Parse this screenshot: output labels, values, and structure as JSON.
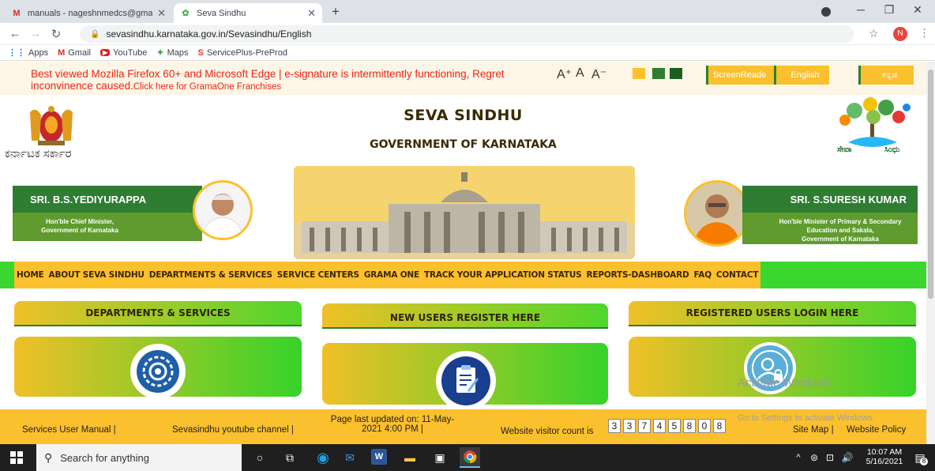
{
  "browser": {
    "tabs": [
      {
        "title": "manuals - nageshnmedcs@gmai",
        "icon": "gmail-icon",
        "active": false
      },
      {
        "title": "Seva Sindhu",
        "icon": "seva-sindhu-favicon",
        "active": true
      }
    ],
    "new_tab": "+",
    "url": "sevasindhu.karnataka.gov.in/Sevasindhu/English",
    "profile_initial": "N",
    "bookmarks": [
      {
        "label": "Apps",
        "icon": "apps-grid-icon"
      },
      {
        "label": "Gmail",
        "icon": "gmail-icon"
      },
      {
        "label": "YouTube",
        "icon": "youtube-icon"
      },
      {
        "label": "Maps",
        "icon": "maps-icon"
      },
      {
        "label": "ServicePlus-PreProd",
        "icon": "serviceplus-icon"
      }
    ]
  },
  "notice": {
    "text": "Best viewed Mozilla Firefox 60+ and Microsoft Edge | e-signature is intermittently functioning, Regret inconvinence caused.",
    "link": "Click here for GramaOne Franchises"
  },
  "accessibility": {
    "font_increase": "A⁺",
    "font_normal": "A",
    "font_decrease": "A⁻",
    "screen_reader": "ScreenReade",
    "english": "English",
    "kannada": "ಕನ್ನಡ",
    "swatch_colors": [
      "#fbc02d",
      "#2e7d32",
      "#1b5e20"
    ]
  },
  "header": {
    "title": "SEVA SINDHU",
    "subtitle": "GOVERNMENT OF KARNATAKA",
    "kannada_gov": "ಕರ್ನಾಟಕ ಸರ್ಕಾರ",
    "logo_text_left": "ಸೇವಾ",
    "logo_text_right": "ಸಿಂಧು"
  },
  "ministers": {
    "left": {
      "name": "SRI. B.S.YEDIYURAPPA",
      "role_line1": "Hon'ble Chief Minister,",
      "role_line2": "Government of Karnataka"
    },
    "right": {
      "name": "SRI. S.SURESH KUMAR",
      "role_line1": "Hon'ble Minister of Primary & Secondary",
      "role_line2": "Education and Sakala,",
      "role_line3": "Government of Karnataka"
    }
  },
  "nav": {
    "items": [
      "HOME",
      "ABOUT SEVA SINDHU",
      "DEPARTMENTS & SERVICES",
      "SERVICE CENTERS",
      "GRAMA ONE",
      "TRACK YOUR APPLICATION STATUS",
      "REPORTS-DASHBOARD",
      "FAQ",
      "CONTACT"
    ]
  },
  "cards": [
    {
      "title": "DEPARTMENTS & SERVICES",
      "icon": "gear-icon"
    },
    {
      "title": "NEW USERS REGISTER HERE",
      "icon": "clipboard-pen-icon"
    },
    {
      "title": "REGISTERED USERS LOGIN HERE",
      "icon": "user-lock-icon"
    }
  ],
  "footer": {
    "manual": "Services User Manual |",
    "youtube": "Sevasindhu youtube channel |",
    "updated_line1": "Page last updated on: 11-May-",
    "updated_line2": "2021 4:00 PM |",
    "visitor_label": "Website visitor count is",
    "visitor_digits": [
      "3",
      "3",
      "7",
      "4",
      "5",
      "8",
      "0",
      "8"
    ],
    "sitemap": "Site Map |",
    "policy": "Website Policy"
  },
  "watermark": {
    "title": "Activate Windows",
    "sub": "Go to Settings to activate Windows."
  },
  "taskbar": {
    "search_placeholder": "Search for anything",
    "time": "10:07 AM",
    "date": "5/16/2021",
    "notification_count": "8"
  }
}
